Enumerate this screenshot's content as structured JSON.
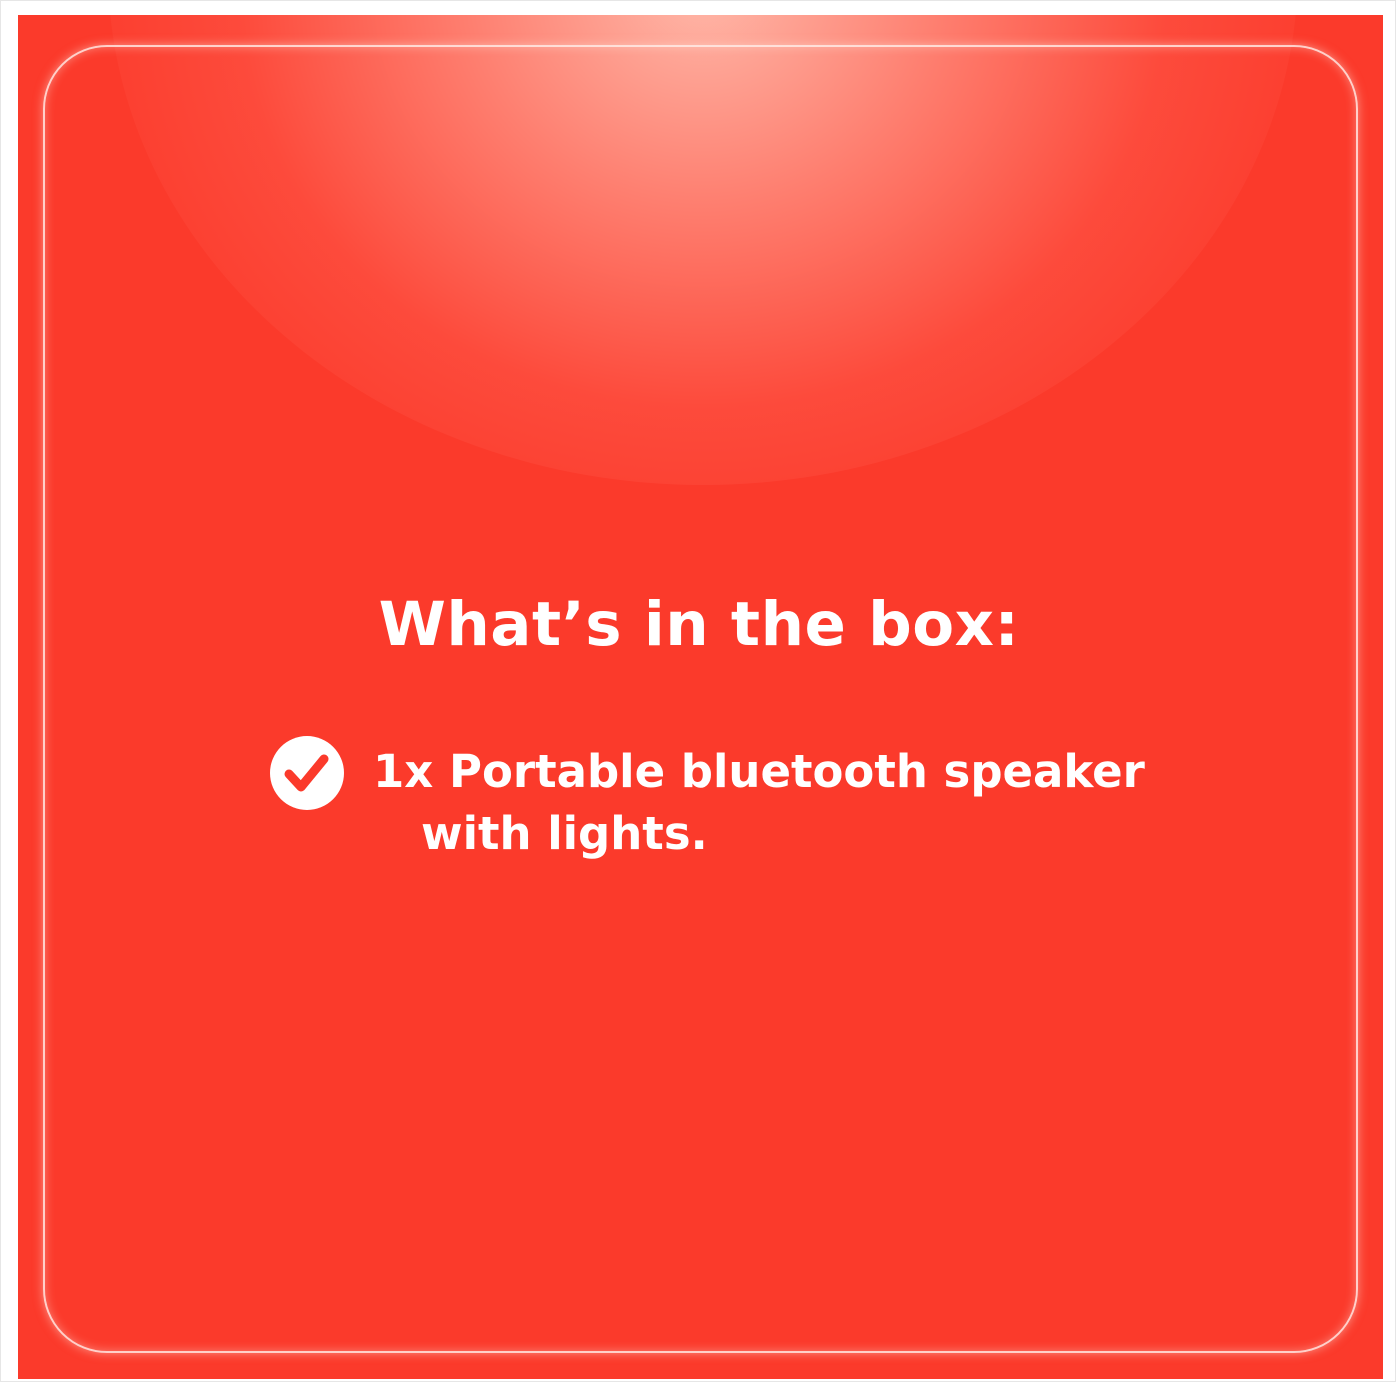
{
  "colors": {
    "background": "#fb3a2b",
    "text": "#ffffff",
    "frame_border": "#e6e6e6"
  },
  "heading": "What’s in the box:",
  "items": [
    {
      "icon": "check-circle-icon",
      "line1": "1x Portable bluetooth speaker",
      "line2": "with lights."
    }
  ]
}
